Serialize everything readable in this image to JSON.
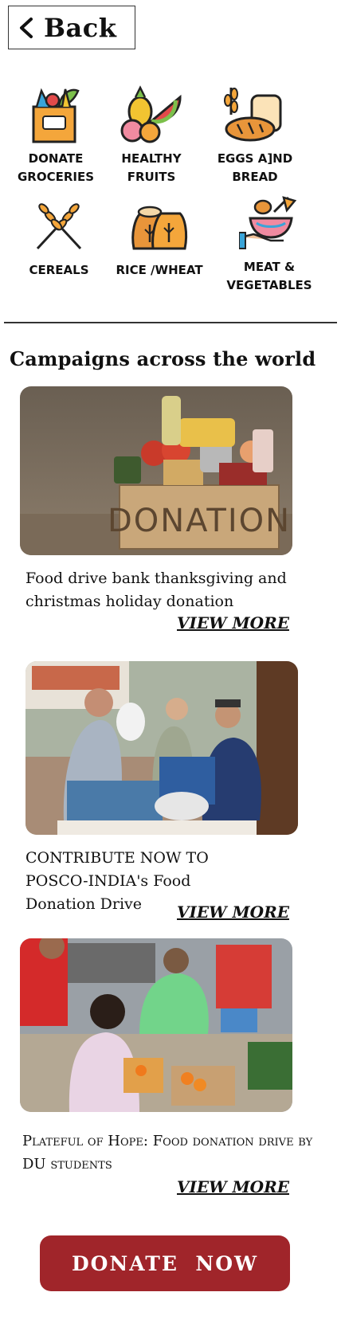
{
  "header": {
    "back_label": "Back",
    "back_icon": "chevron-left-icon"
  },
  "categories": [
    {
      "label": "DONATE GROCERIES",
      "icon": "grocery-bag-icon"
    },
    {
      "label": "HEALTHY FRUITS",
      "icon": "fruits-icon"
    },
    {
      "label": "EGGS A]ND BREAD",
      "icon": "eggs-bread-icon"
    },
    {
      "label": "CEREALS",
      "icon": "wheat-icon"
    },
    {
      "label": "RICE /WHEAT",
      "icon": "grain-sacks-icon"
    },
    {
      "label": "MEAT & VEGETABLES",
      "icon": "meat-vegetables-icon"
    }
  ],
  "section": {
    "title": "Campaigns across the world"
  },
  "campaigns": [
    {
      "caption": "Food drive bank thanksgiving and christmas holiday donation",
      "more": "VIEW MORE",
      "image": "donation-box-photo"
    },
    {
      "caption": "CONTRIBUTE NOW TO  POSCO-INDIA's Food Donation Drive",
      "more": "VIEW MORE",
      "image": "volunteers-packing-photo"
    },
    {
      "caption": "Plateful of Hope: Food donation drive by DU students",
      "more": "VIEW MORE",
      "image": "students-sorting-photo"
    }
  ],
  "cta": {
    "label": "DONATE  NOW"
  },
  "colors": {
    "cta_bg": "#a0252a",
    "text": "#111111",
    "icon_orange": "#f4a63b",
    "icon_outline": "#222222"
  }
}
